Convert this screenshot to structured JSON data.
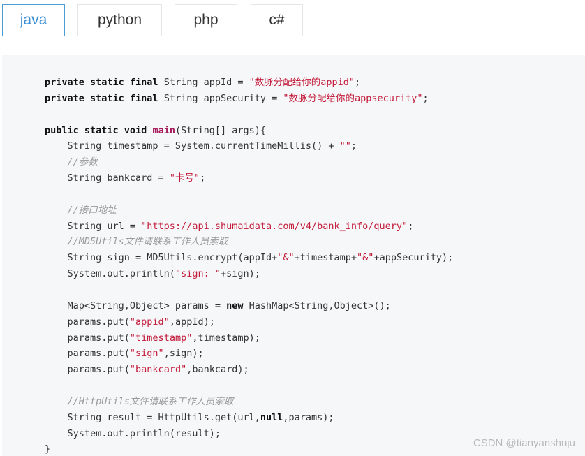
{
  "tabs": [
    {
      "label": "java",
      "active": true
    },
    {
      "label": "python",
      "active": false
    },
    {
      "label": "php",
      "active": false
    },
    {
      "label": "c#",
      "active": false
    }
  ],
  "code_lines": [
    [
      {
        "t": "kw",
        "v": "private static final"
      },
      {
        "t": "pl",
        "v": " String appId = "
      },
      {
        "t": "str",
        "v": "\"数脉分配给你的appid\""
      },
      {
        "t": "pl",
        "v": ";"
      }
    ],
    [
      {
        "t": "kw",
        "v": "private static final"
      },
      {
        "t": "pl",
        "v": " String appSecurity = "
      },
      {
        "t": "str",
        "v": "\"数脉分配给你的appsecurity\""
      },
      {
        "t": "pl",
        "v": ";"
      }
    ],
    [],
    [
      {
        "t": "kw",
        "v": "public static void "
      },
      {
        "t": "fn",
        "v": "main"
      },
      {
        "t": "pl",
        "v": "(String[] args){"
      }
    ],
    [
      {
        "t": "pl",
        "v": "    String timestamp = System.currentTimeMillis() + "
      },
      {
        "t": "str",
        "v": "\"\""
      },
      {
        "t": "pl",
        "v": ";"
      }
    ],
    [
      {
        "t": "cm",
        "v": "    //参数"
      }
    ],
    [
      {
        "t": "pl",
        "v": "    String bankcard = "
      },
      {
        "t": "str",
        "v": "\"卡号\""
      },
      {
        "t": "pl",
        "v": ";"
      }
    ],
    [],
    [
      {
        "t": "cm",
        "v": "    //接口地址"
      }
    ],
    [
      {
        "t": "pl",
        "v": "    String url = "
      },
      {
        "t": "str",
        "v": "\"https://api.shumaidata.com/v4/bank_info/query\""
      },
      {
        "t": "pl",
        "v": ";"
      }
    ],
    [
      {
        "t": "cm",
        "v": "    //MD5Utils文件请联系工作人员索取"
      }
    ],
    [
      {
        "t": "pl",
        "v": "    String sign = MD5Utils.encrypt(appId+"
      },
      {
        "t": "str",
        "v": "\"&\""
      },
      {
        "t": "pl",
        "v": "+timestamp+"
      },
      {
        "t": "str",
        "v": "\"&\""
      },
      {
        "t": "pl",
        "v": "+appSecurity);"
      }
    ],
    [
      {
        "t": "pl",
        "v": "    System.out.println("
      },
      {
        "t": "str",
        "v": "\"sign: \""
      },
      {
        "t": "pl",
        "v": "+sign);"
      }
    ],
    [],
    [
      {
        "t": "pl",
        "v": "    Map<String,Object> params = "
      },
      {
        "t": "kw",
        "v": "new"
      },
      {
        "t": "pl",
        "v": " HashMap<String,Object>();"
      }
    ],
    [
      {
        "t": "pl",
        "v": "    params.put("
      },
      {
        "t": "str",
        "v": "\"appid\""
      },
      {
        "t": "pl",
        "v": ",appId);"
      }
    ],
    [
      {
        "t": "pl",
        "v": "    params.put("
      },
      {
        "t": "str",
        "v": "\"timestamp\""
      },
      {
        "t": "pl",
        "v": ",timestamp);"
      }
    ],
    [
      {
        "t": "pl",
        "v": "    params.put("
      },
      {
        "t": "str",
        "v": "\"sign\""
      },
      {
        "t": "pl",
        "v": ",sign);"
      }
    ],
    [
      {
        "t": "pl",
        "v": "    params.put("
      },
      {
        "t": "str",
        "v": "\"bankcard\""
      },
      {
        "t": "pl",
        "v": ",bankcard);"
      }
    ],
    [],
    [
      {
        "t": "cm",
        "v": "    //HttpUtils文件请联系工作人员索取"
      }
    ],
    [
      {
        "t": "pl",
        "v": "    String result = HttpUtils.get(url,"
      },
      {
        "t": "kw",
        "v": "null"
      },
      {
        "t": "pl",
        "v": ",params);"
      }
    ],
    [
      {
        "t": "pl",
        "v": "    System.out.println(result);"
      }
    ],
    [
      {
        "t": "pl",
        "v": "}"
      }
    ]
  ],
  "watermark": "CSDN @tianyanshuju",
  "colors": {
    "active_tab": "#3b8fd4",
    "string": "#c31b3a",
    "function": "#a71d5d",
    "comment": "#9a9a9a",
    "code_bg": "#f6f7f9"
  }
}
